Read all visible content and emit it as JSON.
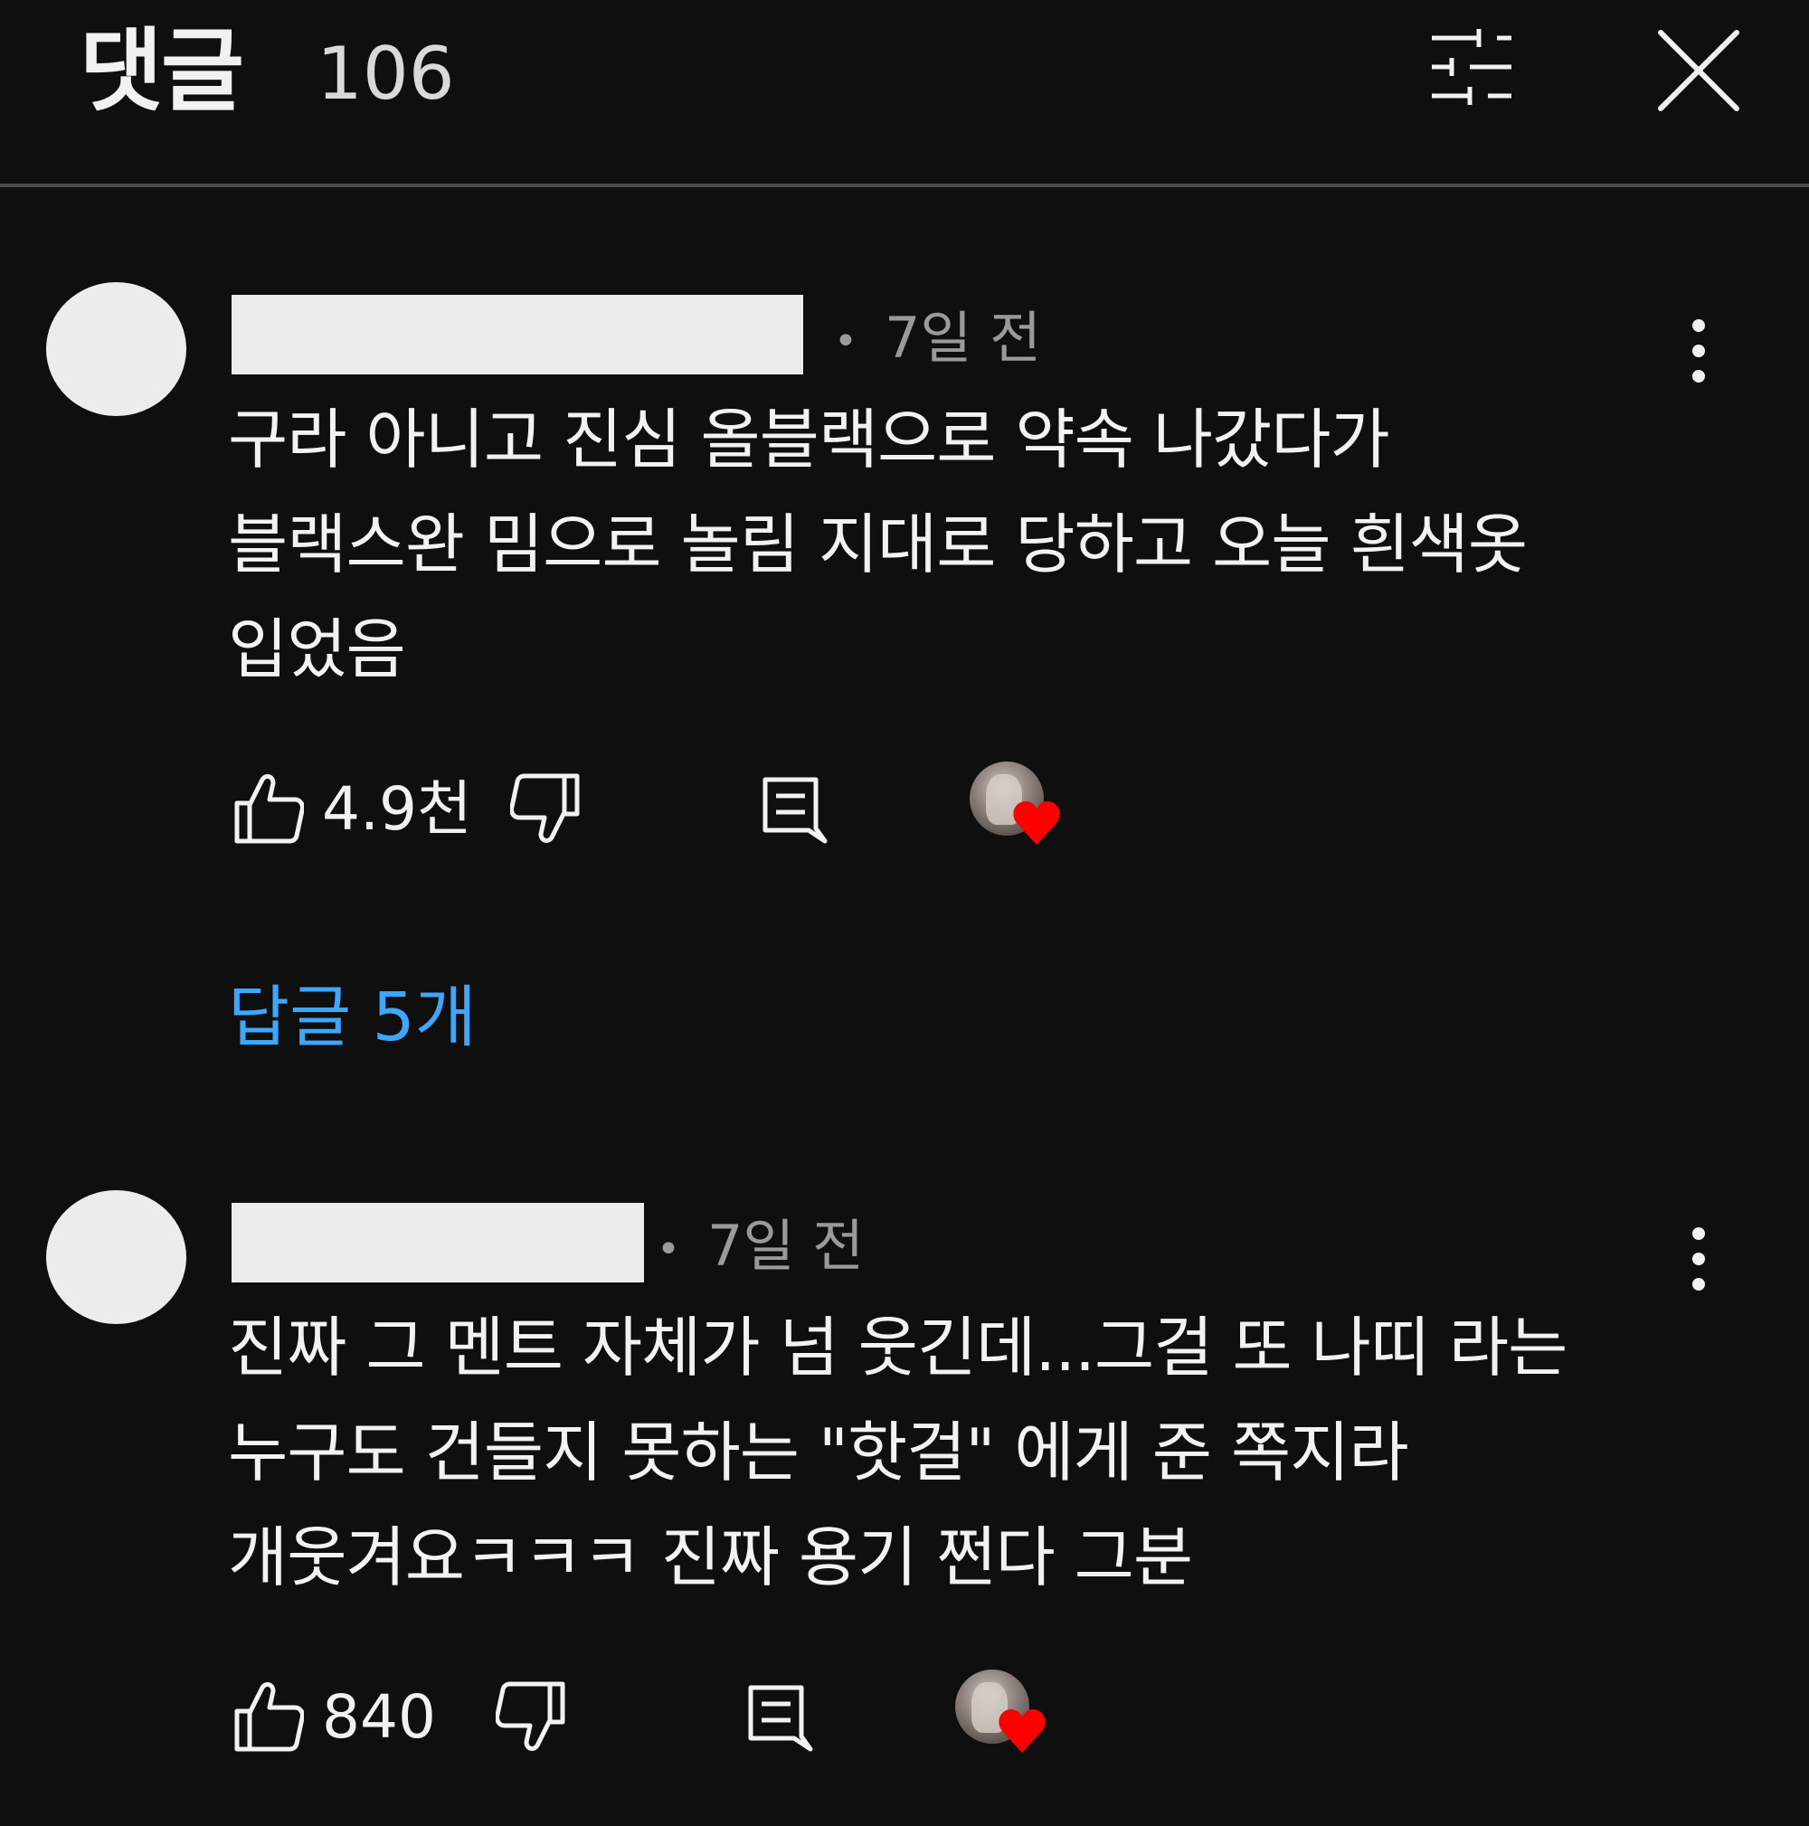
{
  "header": {
    "title": "댓글",
    "count": "106"
  },
  "comments": [
    {
      "time": "7일 전",
      "text": "구라 아니고 진심 올블랙으로 약속 나갔다가\n블랙스완 밈으로 놀림 지대로 당하고 오늘 흰색옷\n입었음",
      "likes": "4.9천",
      "creator_hearted": true,
      "replies_label": "답글 5개"
    },
    {
      "time": "7일 전",
      "text": "진짜 그 멘트 자체가 넘 웃긴데...그걸 또 나띠 라는\n누구도 건들지 못하는 \"핫걸\" 에게 준 쪽지라\n개웃겨요ㅋㅋㅋ 진짜 용기 쩐다 그분",
      "likes": "840",
      "creator_hearted": true
    }
  ],
  "colors": {
    "background": "#0f0f10",
    "accent_link": "#3ea6ff",
    "heart": "#ff0000",
    "meta_text": "#9a9a9a"
  },
  "icons": [
    "filter-icon",
    "close-icon",
    "more-vert-icon",
    "thumb-up-icon",
    "thumb-down-icon",
    "reply-icon",
    "heart-icon"
  ]
}
